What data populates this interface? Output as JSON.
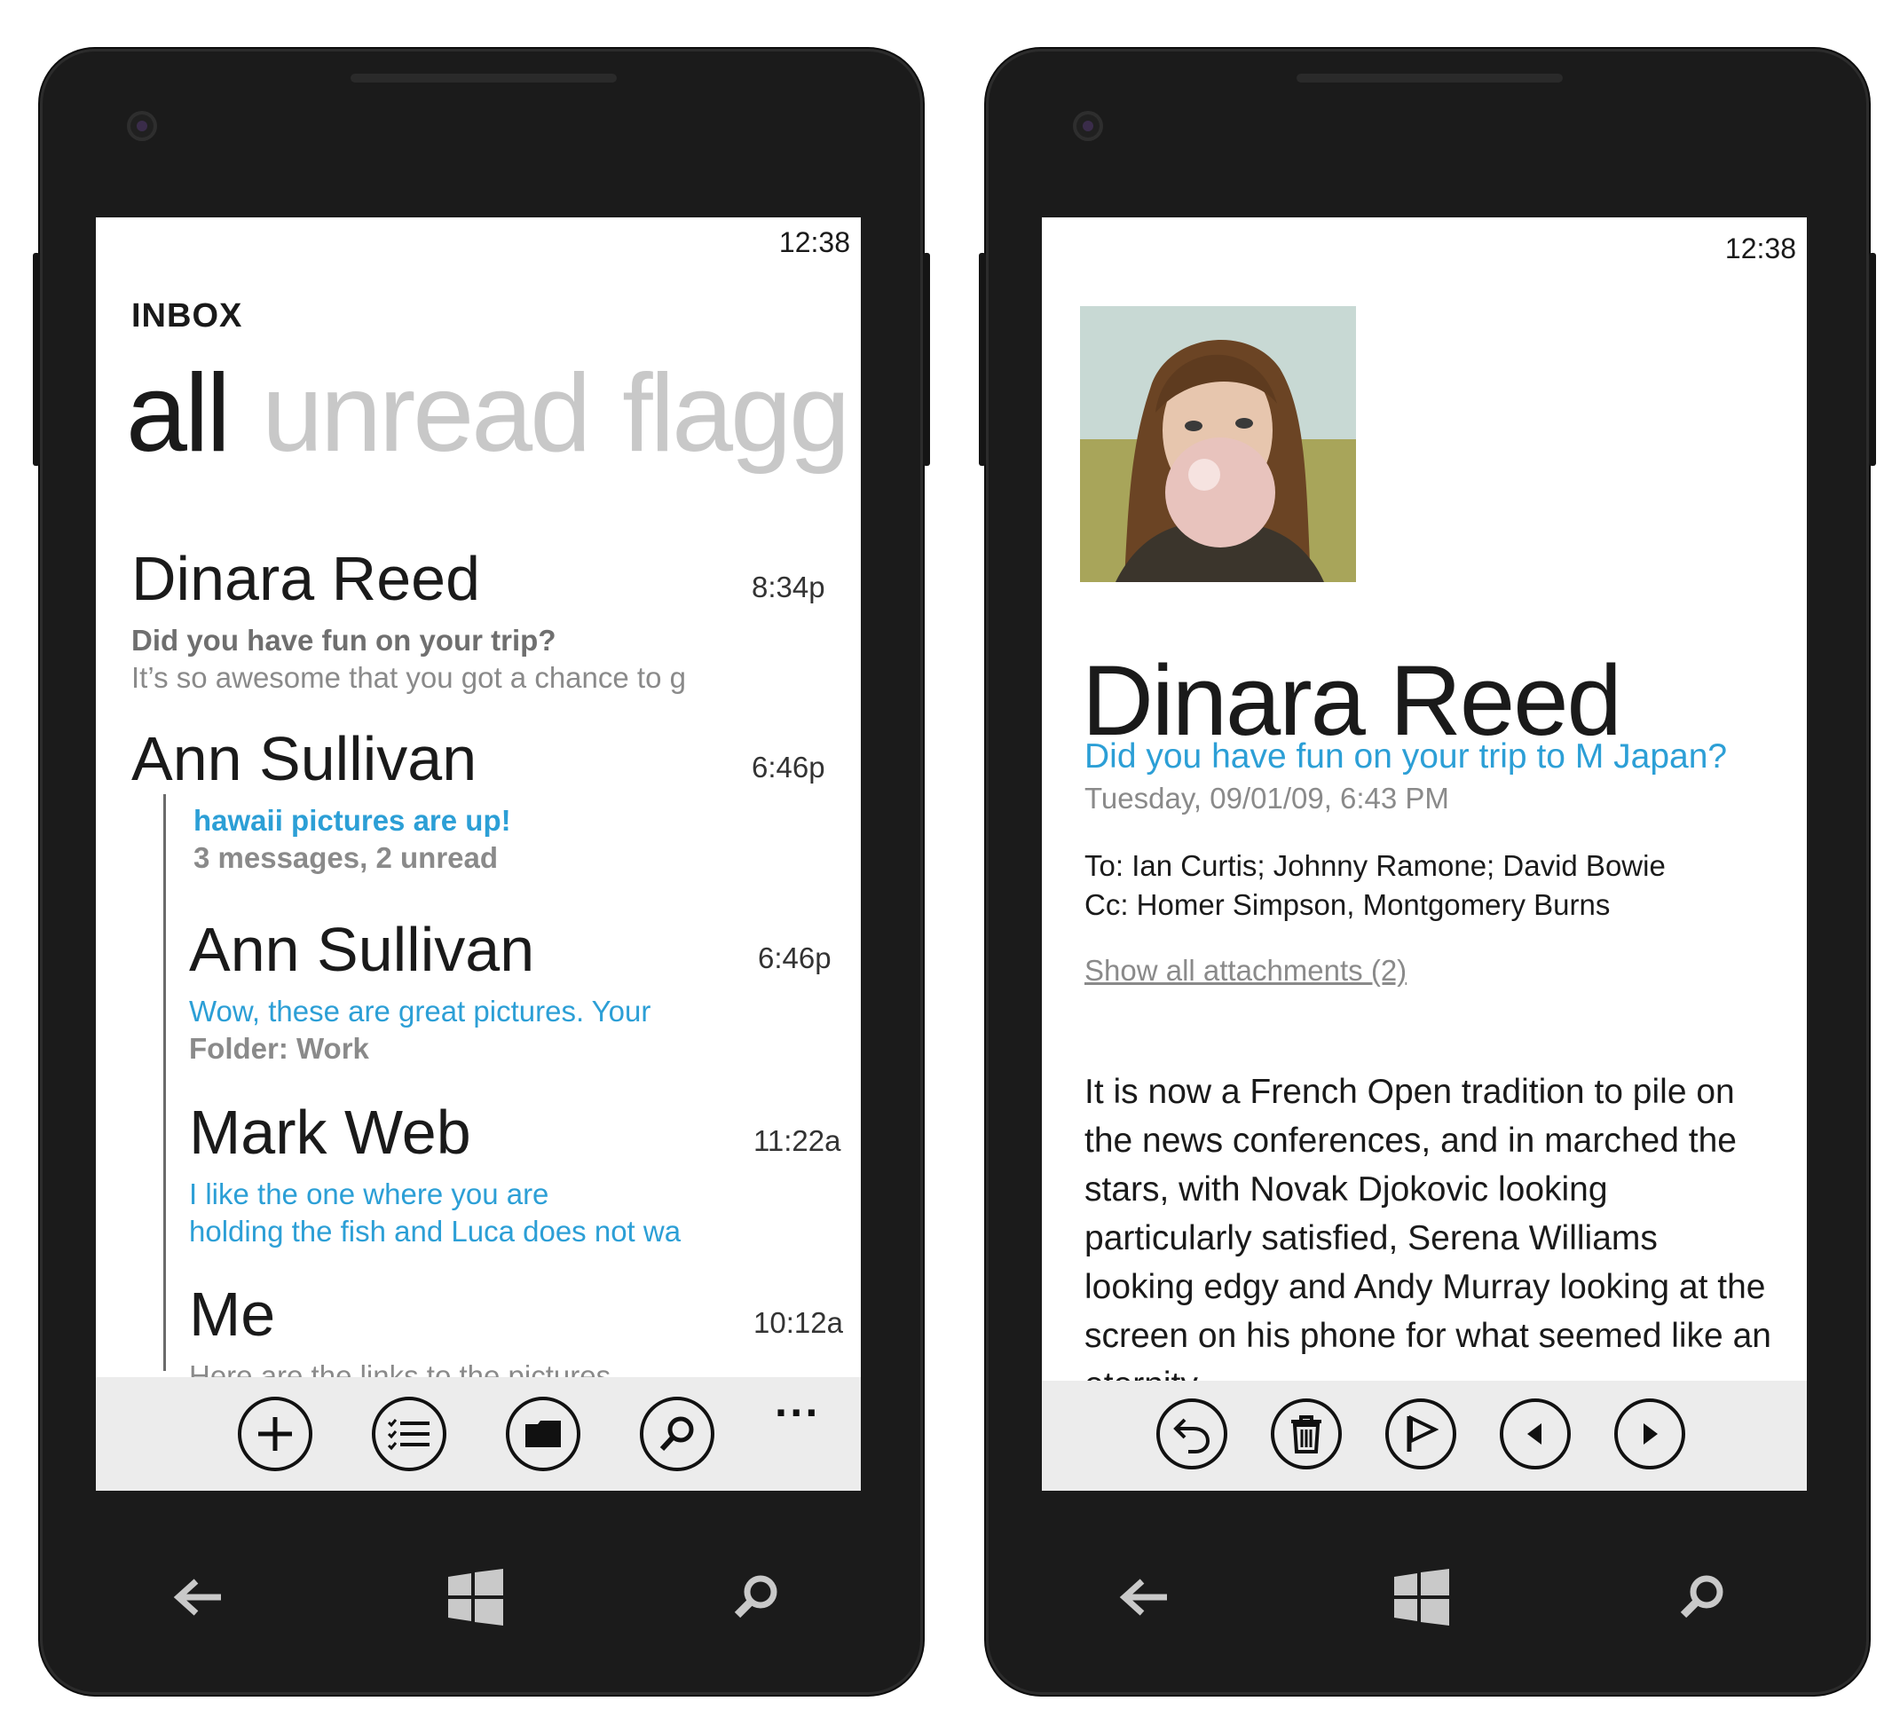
{
  "inbox_screen": {
    "status_time": "12:38",
    "title": "INBOX",
    "pivots": [
      "all",
      "unread",
      "flagg"
    ],
    "messages": [
      {
        "sender": "Dinara Reed",
        "time": "8:34p",
        "line1": "Did you have fun on your trip?",
        "line2": "It’s so awesome that you got a chance to g"
      },
      {
        "sender": "Ann Sullivan",
        "time": "6:46p",
        "line1": "hawaii pictures are up!",
        "line2": "3 messages, 2 unread"
      },
      {
        "sender": "Ann Sullivan",
        "time": "6:46p",
        "line1": "Wow, these are great pictures. Your",
        "line2": "Folder: Work"
      },
      {
        "sender": "Mark Web",
        "time": "11:22a",
        "line1": "I like the one where you are",
        "line2": "holding the fish and Luca does not wa"
      },
      {
        "sender": "Me",
        "time": "10:12a",
        "line1": "Here are the links to the pictures"
      }
    ],
    "appbar": {
      "buttons": [
        "plus-icon",
        "select-list-icon",
        "folder-icon",
        "search-icon"
      ],
      "more": "..."
    }
  },
  "message_screen": {
    "status_time": "12:38",
    "sender": "Dinara Reed",
    "subject": "Did you have fun on your trip to M Japan?",
    "datetime": "Tuesday, 09/01/09, 6:43 PM",
    "to": "To: Ian Curtis; Johnny Ramone; David Bowie",
    "cc": "Cc: Homer Simpson, Montgomery Burns",
    "attachments_link": "Show all attachments (2)",
    "body": "It is now a French Open tradition to pile on the news conferences, and in marched the stars, with Novak Djokovic looking particularly satisfied, Serena Williams looking edgy and Andy Murray looking at the screen on his phone for what seemed like an eternity.",
    "appbar": {
      "buttons": [
        "reply-icon",
        "delete-icon",
        "flag-icon",
        "previous-icon",
        "next-icon"
      ]
    }
  },
  "hardware_buttons": [
    "back-icon",
    "windows-icon",
    "search-icon"
  ],
  "colors": {
    "accent": "#2c9fd6",
    "phone_body": "#1b1b1b",
    "appbar": "#ececec"
  }
}
